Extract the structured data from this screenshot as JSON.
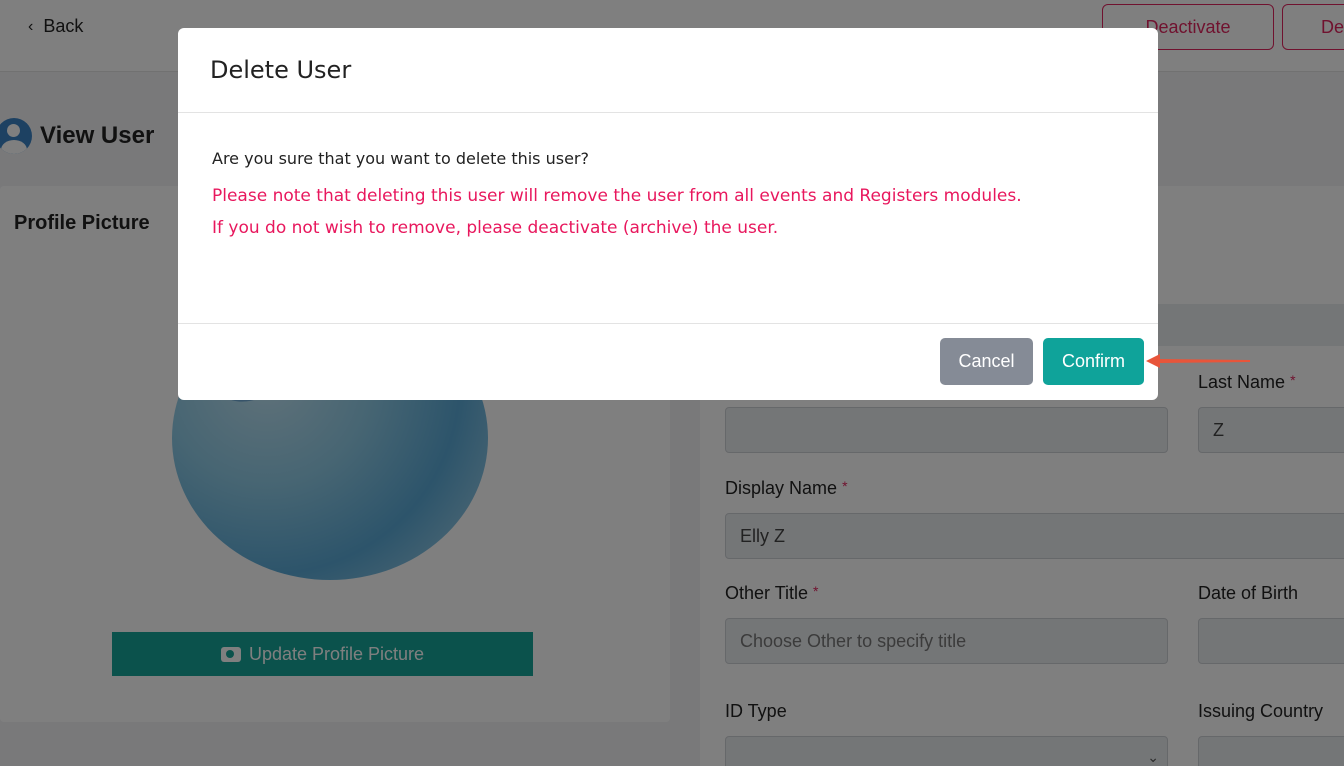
{
  "header": {
    "back_label": "Back",
    "deactivate_label": "Deactivate",
    "delete_label": "De"
  },
  "page": {
    "title": "View User",
    "profile_heading": "Profile Picture",
    "update_picture_label": "Update Profile Picture"
  },
  "form": {
    "last_name_label": "Last Name",
    "last_name_value": "Z",
    "display_name_label": "Display Name",
    "display_name_value": "Elly Z",
    "other_title_label": "Other Title",
    "other_title_placeholder": "Choose Other to specify title",
    "dob_label": "Date of Birth",
    "id_type_label": "ID Type",
    "issuing_country_label": "Issuing Country",
    "required_marker": "*"
  },
  "modal": {
    "title": "Delete User",
    "question": "Are you sure that you want to delete this user?",
    "warning_line1": "Please note that deleting this user will remove the user from all events and Registers modules.",
    "warning_line2": "If you do not wish to remove, please deactivate (archive) the user.",
    "cancel_label": "Cancel",
    "confirm_label": "Confirm"
  },
  "colors": {
    "accent_red": "#e0245e",
    "teal": "#17a598",
    "cancel_grey": "#858b96",
    "annotation_arrow": "#e8553a"
  }
}
